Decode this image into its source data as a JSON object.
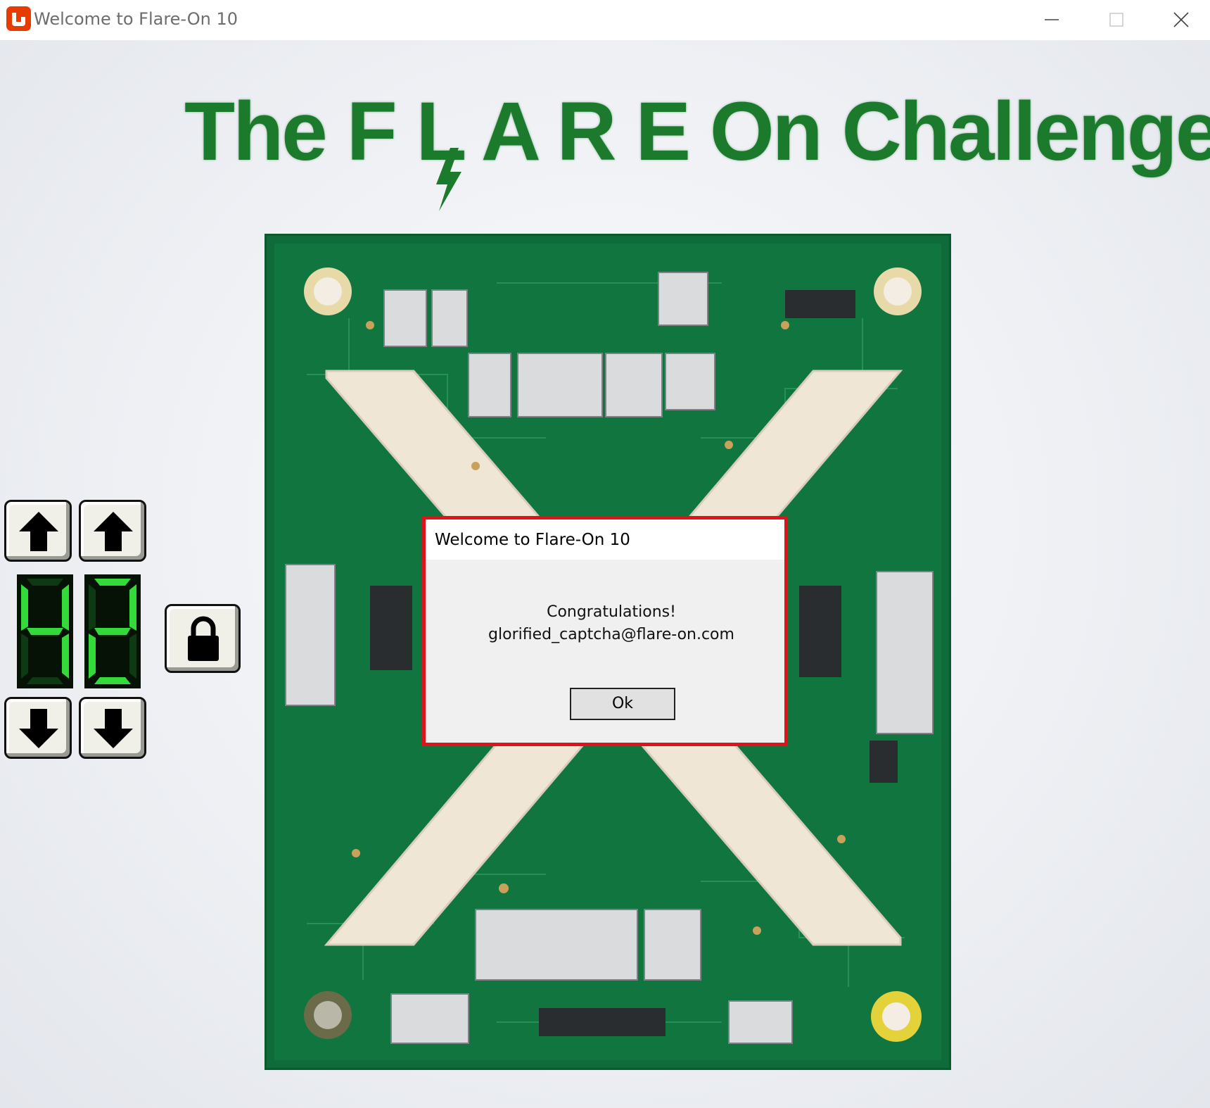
{
  "window": {
    "title": "Welcome to Flare-On 10",
    "icon": "monogame-logo-icon",
    "controls": [
      "minimize-icon",
      "maximize-icon",
      "close-icon"
    ]
  },
  "banner": {
    "text": "The F L A R E On Challenge",
    "color": "#1b7a2b"
  },
  "lock_panel": {
    "digits": [
      "4",
      "2"
    ],
    "digit_color": "#34d93a",
    "up_arrows": [
      "arrow-up-icon",
      "arrow-up-icon"
    ],
    "down_arrows": [
      "arrow-down-icon",
      "arrow-down-icon"
    ],
    "lock_icon": "padlock-icon"
  },
  "dialog": {
    "title": "Welcome to Flare-On 10",
    "message_line1": "Congratulations!",
    "message_line2": "glorified_captcha@flare-on.com",
    "ok_label": "Ok",
    "border_color": "#e0121b"
  }
}
